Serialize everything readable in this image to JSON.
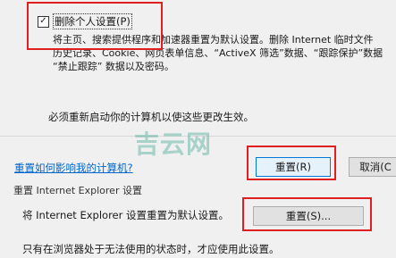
{
  "reset_dialog": {
    "checkbox_label": "删除个人设置(P)",
    "checkbox_checked": true,
    "description_lines": [
      "将主页、搜索提供程序和加速器重置为默认设置。删除 Internet 临时文件",
      "历史记录、Cookie、网页表单信息、“ActiveX 筛选”数据、“跟踪保护”数据",
      "“禁止跟踪” 数据以及密码。"
    ],
    "restart_note": "必须重新启动你的计算机以使这些更改生效。",
    "help_link": "重置如何影响我的计算机?",
    "reset_button": "重置(R)",
    "cancel_button": "取消(C"
  },
  "watermark": "吉云网",
  "advanced_section": {
    "title": "重置 Internet Explorer 设置",
    "text": "将 Internet Explorer 设置重置为默认设置。",
    "reset_button": "重置(S)...",
    "note": "只有在浏览器处于无法使用的状态时，才应使用此设置。"
  },
  "highlight_color": "#e02020"
}
